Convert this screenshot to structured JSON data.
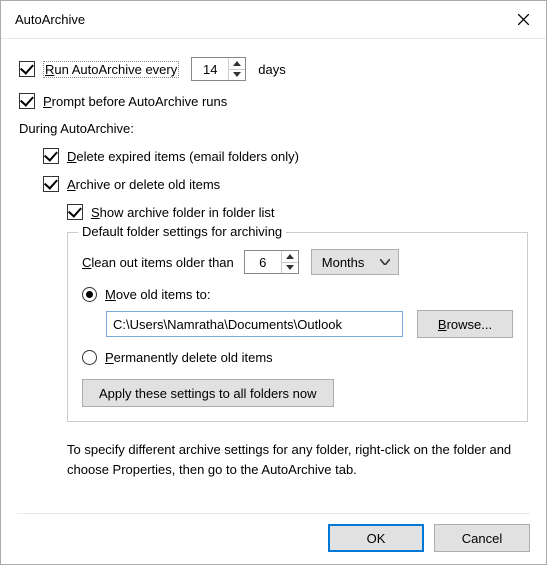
{
  "window": {
    "title": "AutoArchive"
  },
  "runEvery": {
    "label_pre": "R",
    "label_post": "un AutoArchive every",
    "value": "14",
    "unit": "days"
  },
  "prompt": {
    "label_pre": "P",
    "label_post": "rompt before AutoArchive runs"
  },
  "during_label": "During AutoArchive:",
  "deleteExpired": {
    "label_pre": "D",
    "label_post": "elete expired items (email folders only)"
  },
  "archiveDelete": {
    "label_pre": "A",
    "label_post": "rchive or delete old items"
  },
  "showFolder": {
    "label_pre": "S",
    "label_post": "how archive folder in folder list"
  },
  "fieldset": {
    "legend": "Default folder settings for archiving",
    "cleanOut": {
      "label_pre": "C",
      "label_post": "lean out items older than",
      "value": "6",
      "unit": "Months"
    },
    "move": {
      "label_pre": "M",
      "label_post": "ove old items to:",
      "path": "C:\\Users\\Namratha\\Documents\\Outlook",
      "browse_pre": "B",
      "browse_post": "rowse..."
    },
    "permDelete": {
      "label_pre": "P",
      "label_post": "ermanently delete old items"
    },
    "apply_label": "Apply these settings to all folders now"
  },
  "hint": "To specify different archive settings for any folder, right-click on the folder and choose Properties, then go to the AutoArchive tab.",
  "buttons": {
    "ok": "OK",
    "cancel": "Cancel"
  }
}
